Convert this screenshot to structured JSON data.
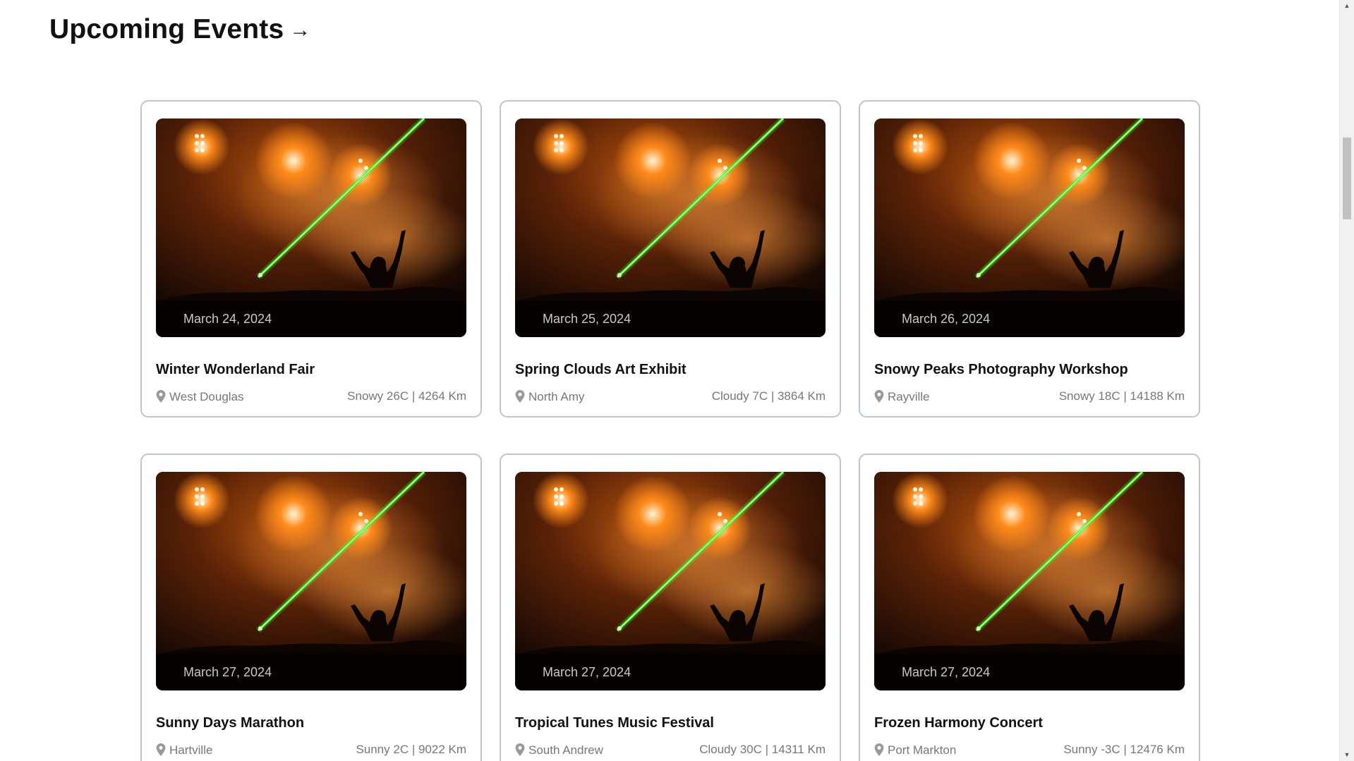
{
  "header": {
    "title": "Upcoming Events",
    "arrow": "→"
  },
  "events": [
    {
      "date": "March 24, 2024",
      "title": "Winter Wonderland Fair",
      "location": "West Douglas",
      "weather": "Snowy 26C | 4264 Km"
    },
    {
      "date": "March 25, 2024",
      "title": "Spring Clouds Art Exhibit",
      "location": "North Amy",
      "weather": "Cloudy 7C | 3864 Km"
    },
    {
      "date": "March 26, 2024",
      "title": "Snowy Peaks Photography Workshop",
      "location": "Rayville",
      "weather": "Snowy 18C | 14188 Km"
    },
    {
      "date": "March 27, 2024",
      "title": "Sunny Days Marathon",
      "location": "Hartville",
      "weather": "Sunny 2C | 9022 Km"
    },
    {
      "date": "March 27, 2024",
      "title": "Tropical Tunes Music Festival",
      "location": "South Andrew",
      "weather": "Cloudy 30C | 14311 Km"
    },
    {
      "date": "March 27, 2024",
      "title": "Frozen Harmony Concert",
      "location": "Port Markton",
      "weather": "Sunny -3C | 12476 Km"
    }
  ],
  "icons": {
    "heading_arrow": "arrow-right-icon",
    "location": "map-pin-icon",
    "scroll_up": "scroll-up-arrow",
    "scroll_down": "scroll-down-arrow"
  },
  "colors": {
    "card_border": "#bcc6cc",
    "meta_text": "#777777",
    "laser": "#3dff2e",
    "stage_glow": "#ff8a1a"
  }
}
